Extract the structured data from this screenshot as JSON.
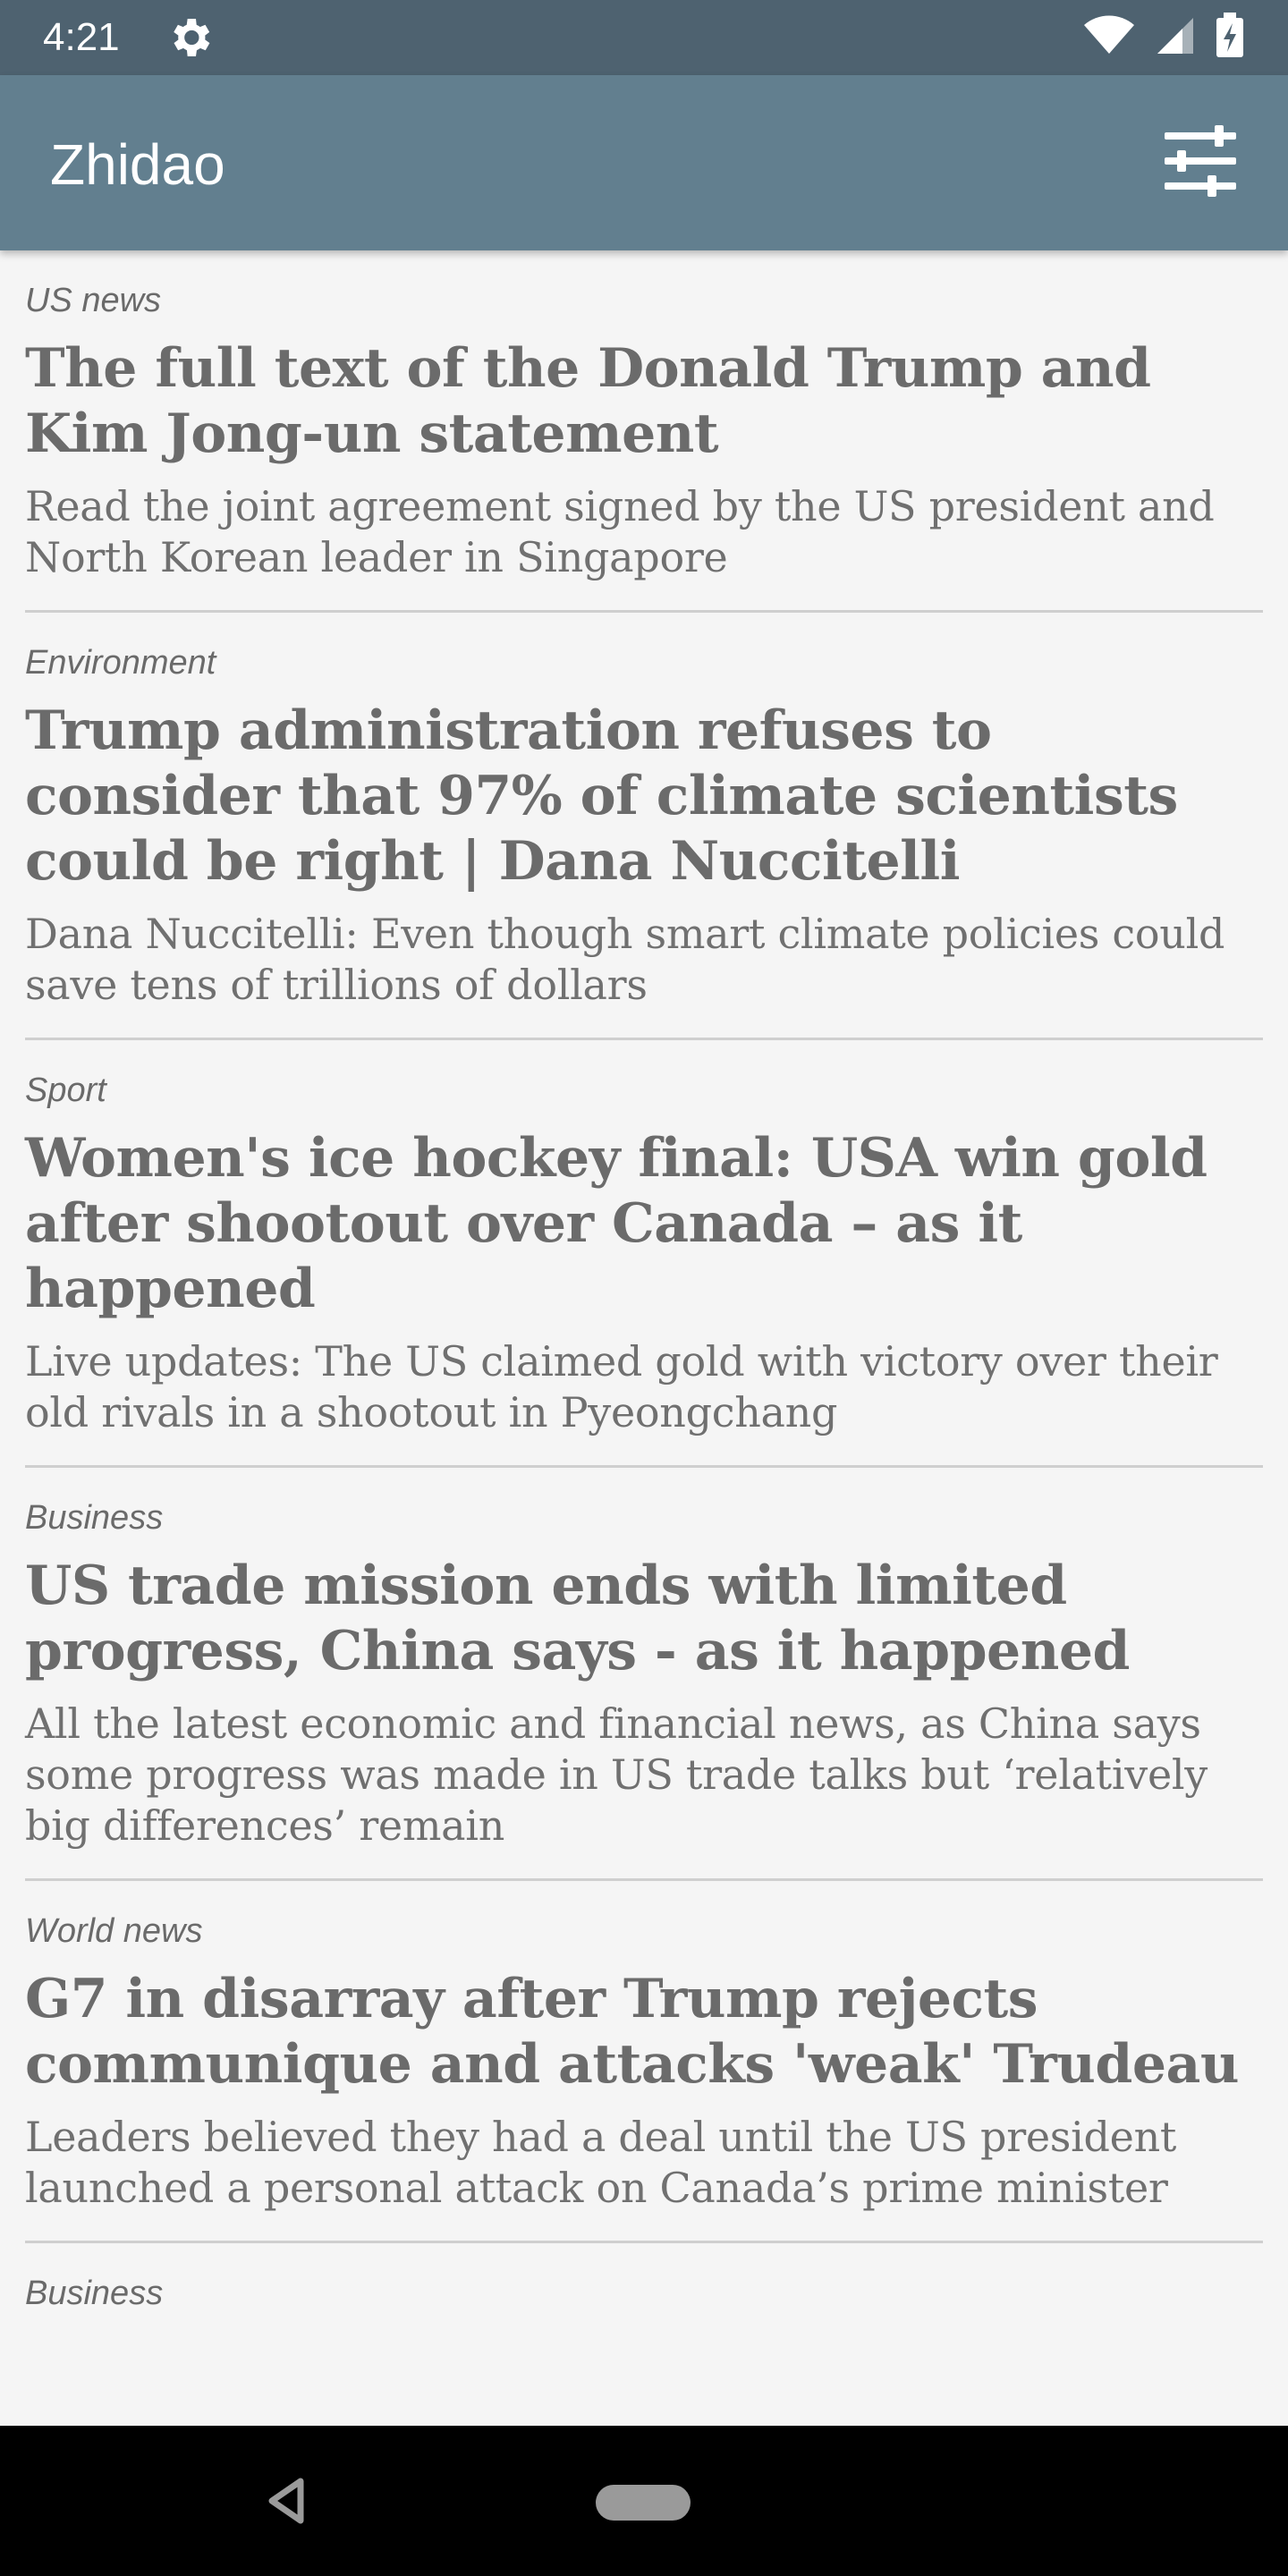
{
  "status_bar": {
    "time": "4:21",
    "icons": [
      "gear-icon",
      "wifi-icon",
      "signal-icon",
      "battery-charging-icon"
    ]
  },
  "app_bar": {
    "title": "Zhidao",
    "filter_icon": "filter-sliders-icon"
  },
  "colors": {
    "status_bar": "#4e6270",
    "app_bar": "#627f8f",
    "background": "#f5f5f5",
    "text": "#6b6b6b"
  },
  "articles": [
    {
      "section": "US news",
      "headline": "The full text of the Donald Trump and Kim Jong-un statement",
      "standfirst": "Read the joint agreement signed by the US president and North Korean leader in Singapore"
    },
    {
      "section": "Environment",
      "headline": "Trump administration refuses to consider that 97% of climate scientists could be right | Dana Nuccitelli",
      "standfirst": "Dana Nuccitelli: Even though smart climate policies could save tens of trillions of dollars"
    },
    {
      "section": "Sport",
      "headline": "Women's ice hockey final: USA win gold after shootout over Canada – as it happened",
      "standfirst": "Live updates: The US claimed gold with victory over their old rivals in a shootout in Pyeongchang"
    },
    {
      "section": "Business",
      "headline": "US trade mission ends with limited progress, China says - as it happened",
      "standfirst": "All the latest economic and financial news, as China says some progress was made in US trade talks but ‘relatively big differences’ remain"
    },
    {
      "section": "World news",
      "headline": "G7 in disarray after Trump rejects communique and attacks 'weak' Trudeau",
      "standfirst": "Leaders believed they had a deal until the US president launched a personal attack on Canada’s prime minister"
    },
    {
      "section": "Business",
      "headline": "",
      "standfirst": ""
    }
  ],
  "nav_bar": {
    "back_icon": "back-triangle-icon",
    "home_icon": "home-pill-icon"
  }
}
